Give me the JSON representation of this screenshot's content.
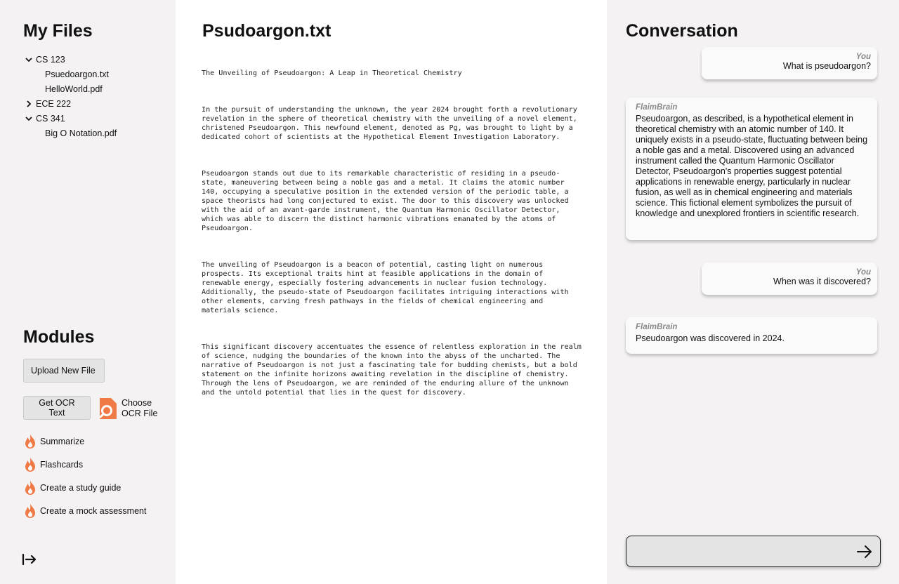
{
  "sidebar": {
    "files_title": "My Files",
    "tree": [
      {
        "type": "folder",
        "label": "CS 123",
        "expanded": true
      },
      {
        "type": "file",
        "label": "Psuedoargon.txt"
      },
      {
        "type": "file",
        "label": "HelloWorld.pdf"
      },
      {
        "type": "folder",
        "label": "ECE 222",
        "expanded": false
      },
      {
        "type": "folder",
        "label": "CS 341",
        "expanded": true
      },
      {
        "type": "file",
        "label": "Big O Notation.pdf"
      }
    ],
    "modules_title": "Modules",
    "upload_label": "Upload New File",
    "ocr_label": "Get OCR Text",
    "choose_ocr_label": "Choose OCR File",
    "modules": [
      {
        "label": "Summarize",
        "icon": "flame-icon"
      },
      {
        "label": "Flashcards",
        "icon": "flame-icon"
      },
      {
        "label": "Create a study guide",
        "icon": "flame-icon"
      },
      {
        "label": "Create a mock assessment",
        "icon": "flame-icon"
      }
    ],
    "accent_color": "#f07a45"
  },
  "document": {
    "title": "Psudoargon.txt",
    "paragraphs": [
      "The Unveiling of Pseudoargon: A Leap in Theoretical Chemistry",
      "In the pursuit of understanding the unknown, the year 2024 brought forth a revolutionary\nrevelation in the sphere of theoretical chemistry with the unveiling of a novel element,\nchristened Pseudoargon. This newfound element, denoted as Pg, was brought to light by a\ndedicated cohort of scientists at the Hypothetical Element Investigation Laboratory.",
      "Pseudoargon stands out due to its remarkable characteristic of residing in a pseudo-\nstate, maneuvering between being a noble gas and a metal. It claims the atomic number\n140, occupying a speculative position in the extended version of the periodic table, a\nspace theorists had long conjectured to exist. The door to this discovery was unlocked\nwith the aid of an avant-garde instrument, the Quantum Harmonic Oscillator Detector,\nwhich was able to discern the distinct harmonic vibrations emanated by the atoms of\nPseudoargon.",
      "The unveiling of Pseudoargon is a beacon of potential, casting light on numerous\nprospects. Its exceptional traits hint at feasible applications in the domain of\nrenewable energy, especially fostering advancements in nuclear fusion technology.\nAdditionally, the pseudo-state of Pseudoargon facilitates intriguing interactions with\nother elements, carving fresh pathways in the fields of chemical engineering and\nmaterials science.",
      "This significant discovery accentuates the essence of relentless exploration in the realm\nof science, nudging the boundaries of the known into the abyss of the uncharted. The\nnarrative of Pseudoargon is not just a fascinating tale for budding chemists, but a bold\nstatement on the infinite horizons awaiting revelation in the discipline of chemistry.\nThrough the lens of Pseudoargon, we are reminded of the enduring allure of the unknown\nand the untold potential that lies in the quest for discovery."
    ]
  },
  "chat": {
    "title": "Conversation",
    "messages": [
      {
        "role": "user",
        "author": "You",
        "text": "What is pseudoargon?"
      },
      {
        "role": "bot",
        "author": "FlaimBrain",
        "text": "Pseudoargon, as described, is a hypothetical element in theoretical chemistry with an atomic number of 140. It uniquely exists in a pseudo-state, fluctuating between being a noble gas and a metal. Discovered using an advanced instrument called the Quantum Harmonic Oscillator Detector, Pseudoargon's properties suggest potential applications in renewable energy, particularly in nuclear fusion, as well as in chemical engineering and materials science. This fictional element symbolizes the pursuit of knowledge and unexplored frontiers in scientific research."
      },
      {
        "role": "user",
        "author": "You",
        "text": "When was it discovered?"
      },
      {
        "role": "bot",
        "author": "FlaimBrain",
        "text": "Pseudoargon was discovered in 2024."
      }
    ],
    "input_value": "",
    "input_placeholder": ""
  }
}
